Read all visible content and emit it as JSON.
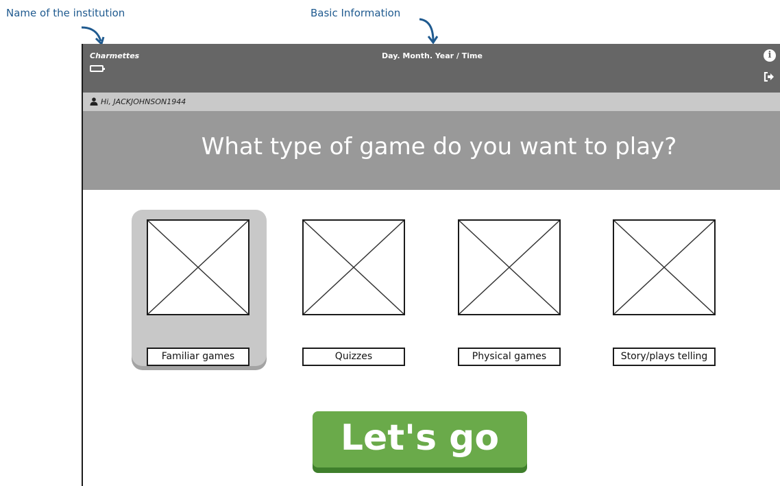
{
  "annotations": {
    "institution_label": "Name of the institution",
    "basic_info_label": "Basic Information"
  },
  "topbar": {
    "institution": "Charmettes",
    "datetime": "Day. Month. Year / Time",
    "icons": [
      "battery-icon",
      "info-icon",
      "logout-icon"
    ]
  },
  "user": {
    "greeting": "Hi, JACKJOHNSON1944",
    "icon": "user-icon"
  },
  "question": "What type of game do you want to play?",
  "game_types": [
    {
      "label": "Familiar games",
      "selected": true
    },
    {
      "label": "Quizzes",
      "selected": false
    },
    {
      "label": "Physical games",
      "selected": false
    },
    {
      "label": "Story/plays telling",
      "selected": false
    }
  ],
  "cta": {
    "label": "Let's go",
    "color": "#6aaa4a"
  },
  "colors": {
    "topbar": "#666666",
    "userbar": "#c9c9c9",
    "question_bar": "#999999",
    "annotation": "#1f5a8f"
  }
}
